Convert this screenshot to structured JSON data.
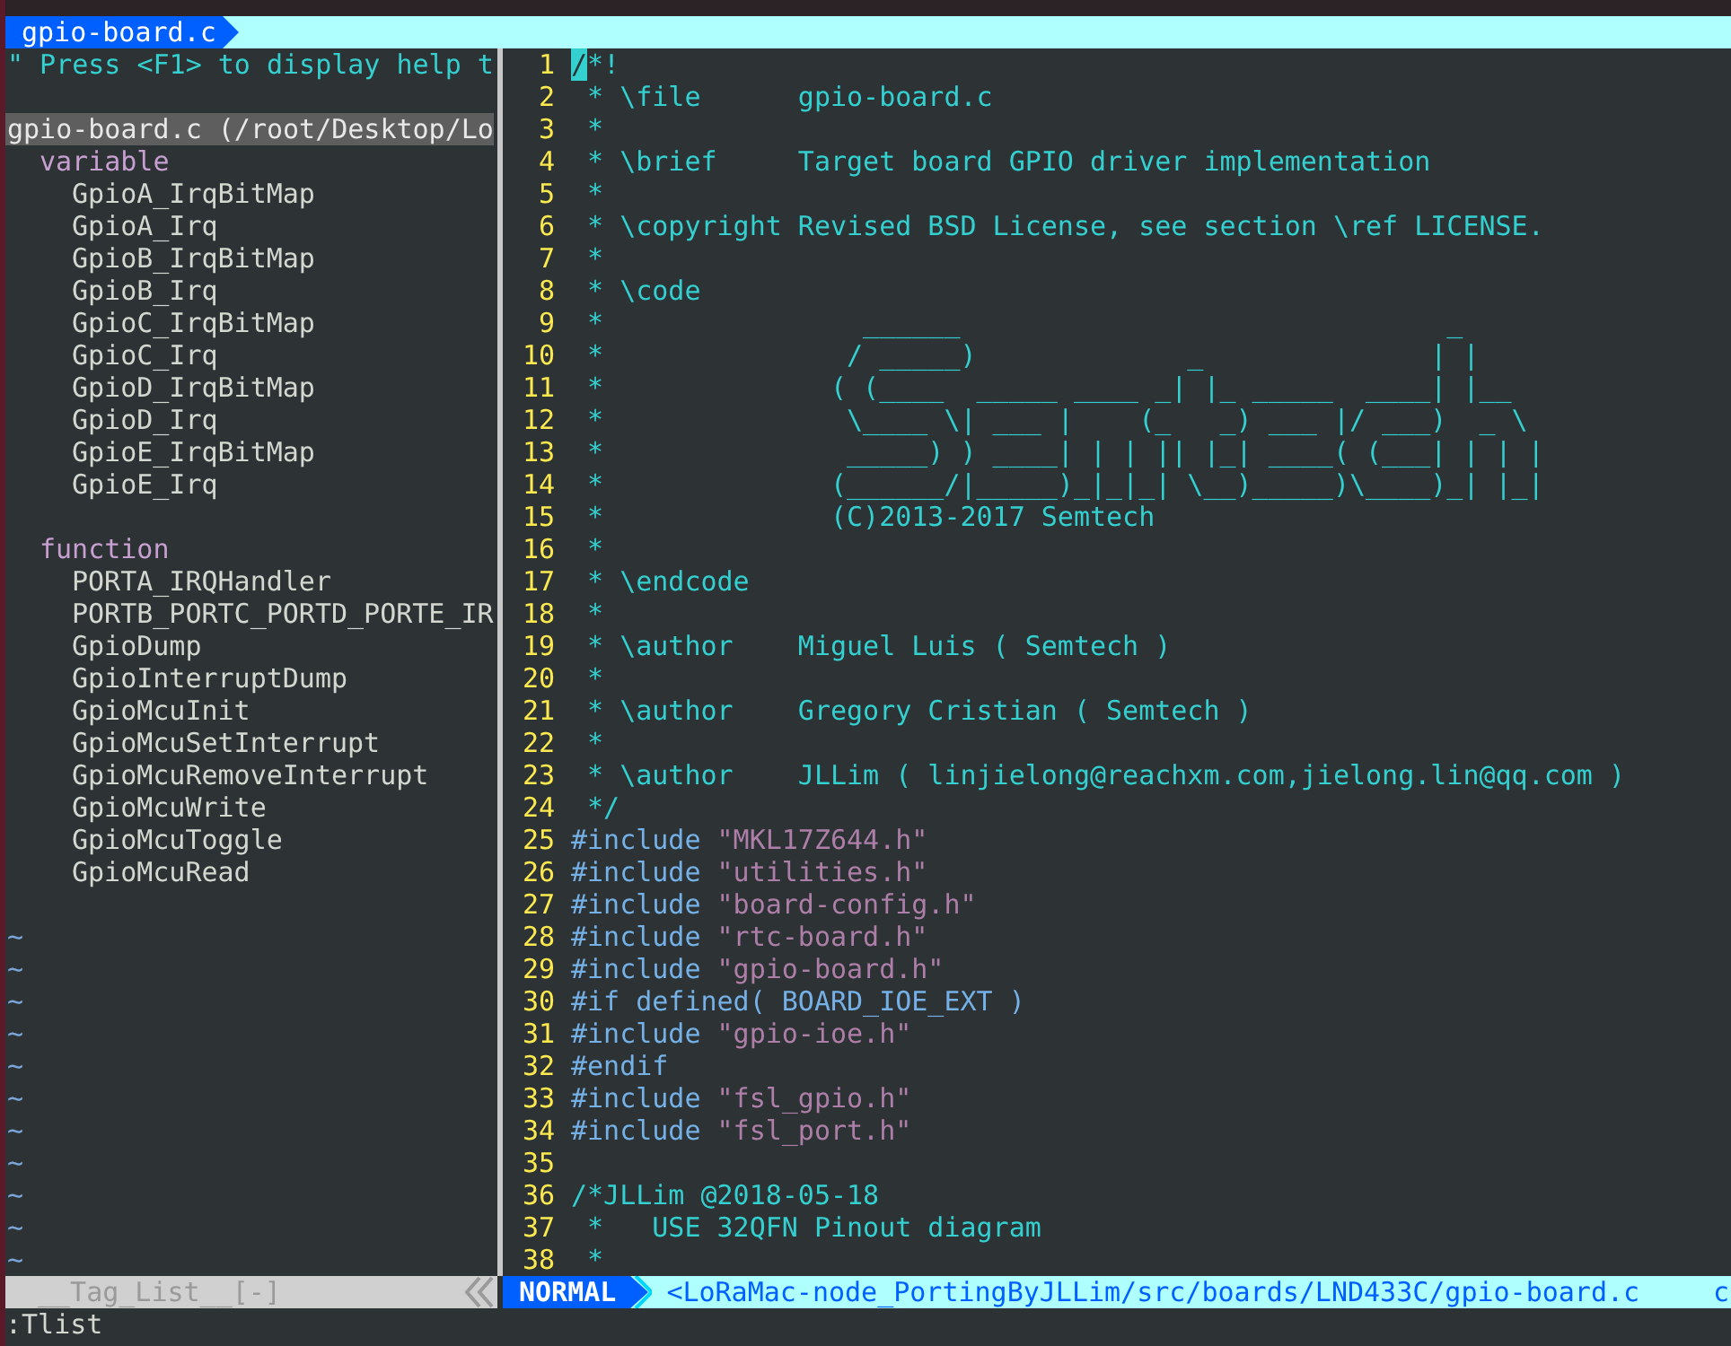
{
  "tabline": {
    "tabs": [
      {
        "label": "gpio-board.c",
        "selected": true
      }
    ]
  },
  "taglist": {
    "help": "\" Press <F1> to display help t",
    "file": "gpio-board.c (/root/Desktop/Lo",
    "groups": [
      {
        "label": "variable",
        "children": [
          "GpioA_IrqBitMap",
          "GpioA_Irq",
          "GpioB_IrqBitMap",
          "GpioB_Irq",
          "GpioC_IrqBitMap",
          "GpioC_Irq",
          "GpioD_IrqBitMap",
          "GpioD_Irq",
          "GpioE_IrqBitMap",
          "GpioE_Irq"
        ]
      },
      {
        "label": "function",
        "children": [
          "PORTA_IRQHandler",
          "PORTB_PORTC_PORTD_PORTE_IR",
          "GpioDump",
          "GpioInterruptDump",
          "GpioMcuInit",
          "GpioMcuSetInterrupt",
          "GpioMcuRemoveInterrupt",
          "GpioMcuWrite",
          "GpioMcuToggle",
          "GpioMcuRead"
        ]
      }
    ],
    "filler": [
      "~",
      "~",
      "~",
      "~",
      "~",
      "~",
      "~",
      "~",
      "~",
      "~",
      "~"
    ]
  },
  "editor": {
    "lines": [
      {
        "n": "1",
        "parts": [
          {
            "kind": "cursor",
            "text": "/"
          },
          {
            "kind": "comment",
            "text": "*!"
          }
        ]
      },
      {
        "n": "2",
        "parts": [
          {
            "kind": "comment",
            "text": " * \\file      gpio-board.c"
          }
        ]
      },
      {
        "n": "3",
        "parts": [
          {
            "kind": "comment",
            "text": " *"
          }
        ]
      },
      {
        "n": "4",
        "parts": [
          {
            "kind": "comment",
            "text": " * \\brief     Target board GPIO driver implementation"
          }
        ]
      },
      {
        "n": "5",
        "parts": [
          {
            "kind": "comment",
            "text": " *"
          }
        ]
      },
      {
        "n": "6",
        "parts": [
          {
            "kind": "comment",
            "text": " * \\copyright Revised BSD License, see section \\ref LICENSE."
          }
        ]
      },
      {
        "n": "7",
        "parts": [
          {
            "kind": "comment",
            "text": " *"
          }
        ]
      },
      {
        "n": "8",
        "parts": [
          {
            "kind": "comment",
            "text": " * \\code"
          }
        ]
      },
      {
        "n": "9",
        "parts": [
          {
            "kind": "comment",
            "text": " *                ______                              _"
          }
        ]
      },
      {
        "n": "10",
        "parts": [
          {
            "kind": "comment",
            "text": " *               / _____)             _              | |"
          }
        ]
      },
      {
        "n": "11",
        "parts": [
          {
            "kind": "comment",
            "text": " *              ( (____  _____ ____ _| |_ _____  ____| |__"
          }
        ]
      },
      {
        "n": "12",
        "parts": [
          {
            "kind": "comment",
            "text": " *               \\____ \\| ___ |    (_   _) ___ |/ ___)  _ \\"
          }
        ]
      },
      {
        "n": "13",
        "parts": [
          {
            "kind": "comment",
            "text": " *               _____) ) ____| | | || |_| ____( (___| | | |"
          }
        ]
      },
      {
        "n": "14",
        "parts": [
          {
            "kind": "comment",
            "text": " *              (______/|_____)_|_|_| \\__)_____)\\____)_| |_|"
          }
        ]
      },
      {
        "n": "15",
        "parts": [
          {
            "kind": "comment",
            "text": " *              (C)2013-2017 Semtech"
          }
        ]
      },
      {
        "n": "16",
        "parts": [
          {
            "kind": "comment",
            "text": " *"
          }
        ]
      },
      {
        "n": "17",
        "parts": [
          {
            "kind": "comment",
            "text": " * \\endcode"
          }
        ]
      },
      {
        "n": "18",
        "parts": [
          {
            "kind": "comment",
            "text": " *"
          }
        ]
      },
      {
        "n": "19",
        "parts": [
          {
            "kind": "comment",
            "text": " * \\author    Miguel Luis ( Semtech )"
          }
        ]
      },
      {
        "n": "20",
        "parts": [
          {
            "kind": "comment",
            "text": " *"
          }
        ]
      },
      {
        "n": "21",
        "parts": [
          {
            "kind": "comment",
            "text": " * \\author    Gregory Cristian ( Semtech )"
          }
        ]
      },
      {
        "n": "22",
        "parts": [
          {
            "kind": "comment",
            "text": " *"
          }
        ]
      },
      {
        "n": "23",
        "parts": [
          {
            "kind": "comment",
            "text": " * \\author    JLLim ( linjielong@reachxm.com,jielong.lin@qq.com )"
          }
        ]
      },
      {
        "n": "24",
        "parts": [
          {
            "kind": "comment",
            "text": " */"
          }
        ]
      },
      {
        "n": "25",
        "parts": [
          {
            "kind": "preproc",
            "text": "#include "
          },
          {
            "kind": "string",
            "text": "\"MKL17Z644.h\""
          }
        ]
      },
      {
        "n": "26",
        "parts": [
          {
            "kind": "preproc",
            "text": "#include "
          },
          {
            "kind": "string",
            "text": "\"utilities.h\""
          }
        ]
      },
      {
        "n": "27",
        "parts": [
          {
            "kind": "preproc",
            "text": "#include "
          },
          {
            "kind": "string",
            "text": "\"board-config.h\""
          }
        ]
      },
      {
        "n": "28",
        "parts": [
          {
            "kind": "preproc",
            "text": "#include "
          },
          {
            "kind": "string",
            "text": "\"rtc-board.h\""
          }
        ]
      },
      {
        "n": "29",
        "parts": [
          {
            "kind": "preproc",
            "text": "#include "
          },
          {
            "kind": "string",
            "text": "\"gpio-board.h\""
          }
        ]
      },
      {
        "n": "30",
        "parts": [
          {
            "kind": "preproc",
            "text": "#if defined( BOARD_IOE_EXT )"
          }
        ]
      },
      {
        "n": "31",
        "parts": [
          {
            "kind": "preproc",
            "text": "#include "
          },
          {
            "kind": "string",
            "text": "\"gpio-ioe.h\""
          }
        ]
      },
      {
        "n": "32",
        "parts": [
          {
            "kind": "preproc",
            "text": "#endif"
          }
        ]
      },
      {
        "n": "33",
        "parts": [
          {
            "kind": "preproc",
            "text": "#include "
          },
          {
            "kind": "string",
            "text": "\"fsl_gpio.h\""
          }
        ]
      },
      {
        "n": "34",
        "parts": [
          {
            "kind": "preproc",
            "text": "#include "
          },
          {
            "kind": "string",
            "text": "\"fsl_port.h\""
          }
        ]
      },
      {
        "n": "35"
      },
      {
        "n": "36",
        "parts": [
          {
            "kind": "comment",
            "text": "/*JLLim @2018-05-18"
          }
        ]
      },
      {
        "n": "37",
        "parts": [
          {
            "kind": "comment",
            "text": " *   USE 32QFN Pinout diagram"
          }
        ]
      },
      {
        "n": "38",
        "parts": [
          {
            "kind": "comment",
            "text": " *"
          }
        ]
      }
    ]
  },
  "status_bar": {
    "left": "__Tag_List__[-]",
    "mode": "NORMAL",
    "path": "<LoRaMac-node_PortingByJLLim/src/boards/LND433C/gpio-board.c",
    "right": "c"
  },
  "command_line": ":Tlist"
}
